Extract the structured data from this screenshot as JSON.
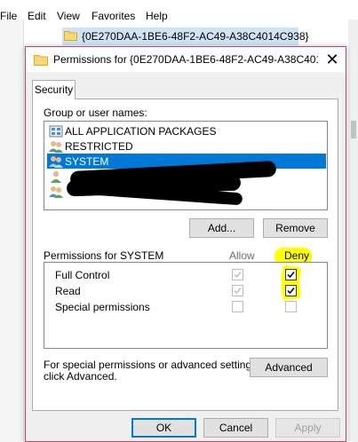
{
  "menubar": {
    "items": [
      "File",
      "Edit",
      "View",
      "Favorites",
      "Help"
    ]
  },
  "tree": {
    "selected_key": "{0E270DAA-1BE6-48F2-AC49-A38C4014C938}"
  },
  "dialog": {
    "title": "Permissions for {0E270DAA-1BE6-48F2-AC49-A38C401...",
    "close_glyph": "✕",
    "tab_label": "Security",
    "group_label": "Group or user names:",
    "users": [
      {
        "name": "ALL APPLICATION PACKAGES",
        "selected": false
      },
      {
        "name": "RESTRICTED",
        "selected": false
      },
      {
        "name": "SYSTEM",
        "selected": true
      },
      {
        "name": "",
        "selected": false
      },
      {
        "name": "",
        "selected": false
      }
    ],
    "add_label": "Add...",
    "remove_label": "Remove",
    "permissions_header": "Permissions for SYSTEM",
    "allow_header": "Allow",
    "deny_header": "Deny",
    "permissions": [
      {
        "name": "Full Control",
        "allow": true,
        "deny": true
      },
      {
        "name": "Read",
        "allow": true,
        "deny": true
      },
      {
        "name": "Special permissions",
        "allow": false,
        "deny": false
      }
    ],
    "special_text_line1": "For special permissions or advanced settings,",
    "special_text_line2": "click Advanced.",
    "advanced_label": "Advanced",
    "ok_label": "OK",
    "cancel_label": "Cancel",
    "apply_label": "Apply"
  },
  "colors": {
    "selection": "#0078d7",
    "highlight": "#ffff00",
    "dialog_border": "#b84a6a"
  }
}
